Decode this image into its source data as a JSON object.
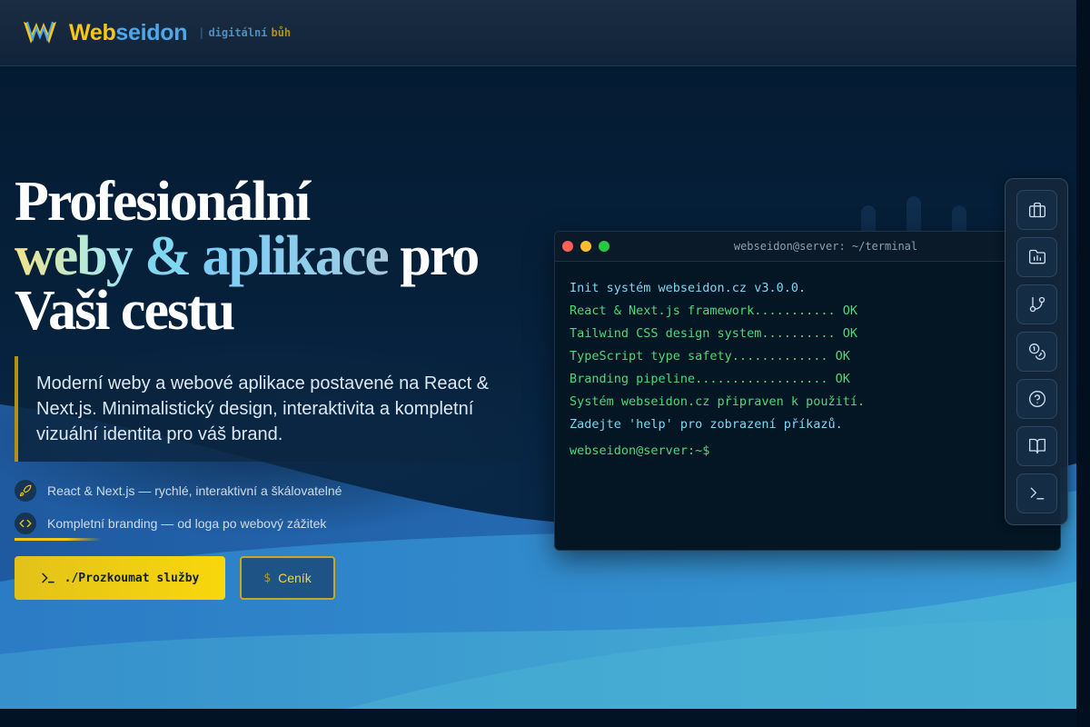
{
  "header": {
    "brand_part1": "Web",
    "brand_part2": "seidon",
    "tagline_sep": "|",
    "tagline_word1": "digitální",
    "tagline_word2": "bůh",
    "logo_icon": "trident-w-logo-icon"
  },
  "hero": {
    "title_line1": "Profesionální",
    "title_weby": "weby",
    "title_amp": "&",
    "title_aplikace": "aplikace",
    "title_pro": "pro",
    "title_line3": "Vaši cestu",
    "lead": "Moderní weby a webové aplikace postavené na React & Next.js. Minimalistický design, interaktivita a kompletní vizuální identita pro váš brand."
  },
  "features": [
    {
      "icon": "rocket-icon",
      "text": "React & Next.js — rychlé, interaktivní a škálovatelné"
    },
    {
      "icon": "code-icon",
      "text": "Kompletní branding — od loga po webový zážitek"
    }
  ],
  "buttons": {
    "primary_label": "./Prozkoumat služby",
    "primary_icon": "terminal-prompt-icon",
    "secondary_symbol": "$",
    "secondary_label": "Ceník"
  },
  "terminal": {
    "title": "webseidon@server: ~/terminal",
    "lines": [
      {
        "type": "info",
        "text": "Init systém webseidon.cz v3.0.0."
      },
      {
        "type": "ok",
        "text": "React & Next.js framework........... OK"
      },
      {
        "type": "ok",
        "text": "Tailwind CSS design system.......... OK"
      },
      {
        "type": "ok",
        "text": "TypeScript type safety............. OK"
      },
      {
        "type": "ok",
        "text": "Branding pipeline.................. OK"
      },
      {
        "type": "ok",
        "text": "Systém webseidon.cz připraven k použití."
      },
      {
        "type": "info",
        "text": "Zadejte 'help' pro zobrazení příkazů."
      }
    ],
    "prompt": "webseidon@server:~$"
  },
  "dock": {
    "items": [
      {
        "icon": "briefcase-icon"
      },
      {
        "icon": "folder-chart-icon"
      },
      {
        "icon": "git-branch-icon"
      },
      {
        "icon": "coins-icon"
      },
      {
        "icon": "help-circle-icon"
      },
      {
        "icon": "book-open-icon"
      },
      {
        "icon": "terminal-icon"
      }
    ]
  },
  "colors": {
    "brand_yellow": "#f5c518",
    "brand_blue": "#4fa6e8",
    "background": "#041a30",
    "terminal_green": "#4ed87a",
    "terminal_cyan": "#7fd6f2"
  }
}
